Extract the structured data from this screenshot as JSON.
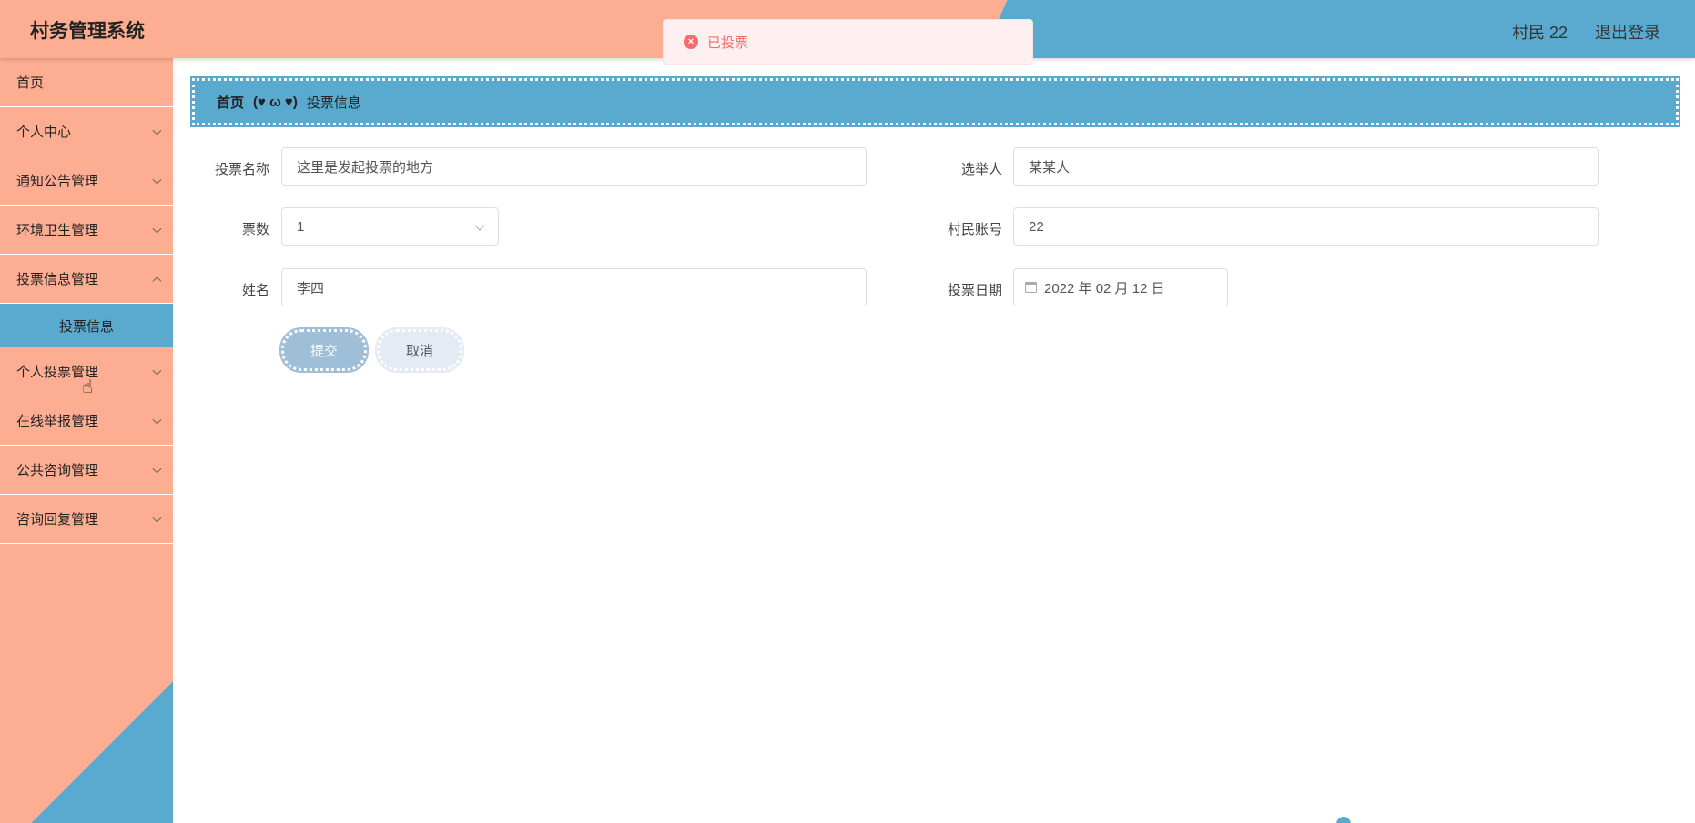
{
  "header": {
    "title": "村务管理系统",
    "user": "村民 22",
    "logout": "退出登录"
  },
  "toast": {
    "icon": "error-circle-icon",
    "message": "已投票"
  },
  "sidebar": {
    "items": [
      {
        "label": "首页",
        "has_children": false
      },
      {
        "label": "个人中心",
        "has_children": true
      },
      {
        "label": "通知公告管理",
        "has_children": true
      },
      {
        "label": "环境卫生管理",
        "has_children": true
      },
      {
        "label": "投票信息管理",
        "has_children": true,
        "expanded": true
      },
      {
        "label": "个人投票管理",
        "has_children": true
      },
      {
        "label": "在线举报管理",
        "has_children": true
      },
      {
        "label": "公共咨询管理",
        "has_children": true
      },
      {
        "label": "咨询回复管理",
        "has_children": true
      }
    ],
    "active_sub": "投票信息"
  },
  "breadcrumb": {
    "home": "首页",
    "separator": "(♥ ω ♥)",
    "current": "投票信息"
  },
  "form": {
    "vote_name_label": "投票名称",
    "vote_name_value": "这里是发起投票的地方",
    "candidate_label": "选举人",
    "candidate_value": "某某人",
    "votes_label": "票数",
    "votes_value": "1",
    "account_label": "村民账号",
    "account_value": "22",
    "name_label": "姓名",
    "name_value": "李四",
    "date_label": "投票日期",
    "date_value": "2022 年 02 月 12 日",
    "submit": "提交",
    "cancel": "取消"
  },
  "colors": {
    "peach": "#fdae92",
    "blue": "#5aa9cf",
    "error": "#f56c6c"
  }
}
